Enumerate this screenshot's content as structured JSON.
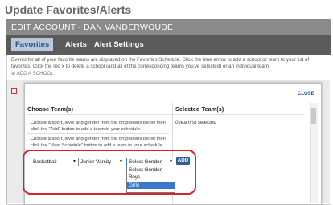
{
  "page_title": "Update Favorites/Alerts",
  "edit_header": "EDIT ACCOUNT -  DAN VANDERWOUDE",
  "tabs": [
    {
      "label": "Favorites",
      "active": true
    },
    {
      "label": "Alerts",
      "active": false
    },
    {
      "label": "Alert Settings",
      "active": false
    }
  ],
  "info_text": "Events for all of your favorite teams are displayed on the Favorites Schedule. Click the blue arrow to add a school or team to your list of favorites. Click the red x to delete a school (and all of the corresponding teams you've selected) or an individual team.",
  "add_school_link": "ADD A SCHOOL",
  "modal": {
    "close_label": "CLOSE",
    "left_header": "Choose Team(s)",
    "right_header": "Selected Team(s)",
    "help_text_1": "Choose a sport, level and gender from the dropdowns below then click the \"Add\" button to add a team to your schedule.",
    "help_text_2": "Choose a sport, level and gender from the dropdowns below then click the \"View Schedule\" button to add a team to your schedule.",
    "selected_note": "0 team(s) selected",
    "sport_select": "Basketball",
    "level_select": "Junior Varsity",
    "gender_select": "Select Gender",
    "add_button": "ADD",
    "gender_options": [
      {
        "label": "Select Gender",
        "selected": false
      },
      {
        "label": "Boys",
        "selected": false
      },
      {
        "label": "Girls",
        "selected": true
      }
    ]
  },
  "colors": {
    "highlight_red": "#d9232c",
    "header_gray": "#8a8a8a",
    "tab_bar": "#5b5b5b",
    "active_tab": "#b9c9db",
    "add_button_blue": "#2d5e9a",
    "option_selected_blue": "#3b76c9"
  }
}
